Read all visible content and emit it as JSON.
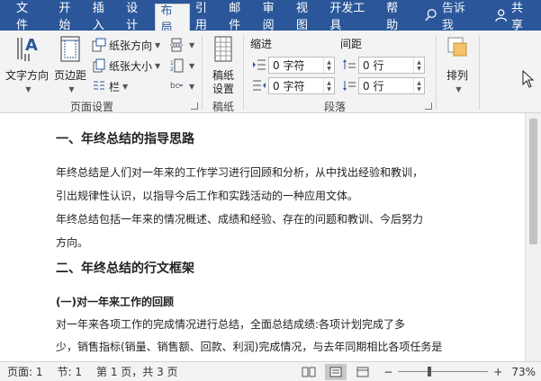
{
  "tabs": [
    {
      "label": "文件",
      "active": false
    },
    {
      "label": "开始",
      "active": false
    },
    {
      "label": "插入",
      "active": false
    },
    {
      "label": "设计",
      "active": false
    },
    {
      "label": "布局",
      "active": true
    },
    {
      "label": "引用",
      "active": false
    },
    {
      "label": "邮件",
      "active": false
    },
    {
      "label": "审阅",
      "active": false
    },
    {
      "label": "视图",
      "active": false
    },
    {
      "label": "开发工具",
      "active": false
    },
    {
      "label": "帮助",
      "active": false
    }
  ],
  "tell_me": "告诉我",
  "share": "共享",
  "ribbon": {
    "page_setup": {
      "label": "页面设置",
      "text_direction": "文字方向",
      "margins": "页边距",
      "orientation": "纸张方向",
      "size": "纸张大小",
      "columns": "栏"
    },
    "manuscript": {
      "label": "稿纸",
      "settings_line1": "稿纸",
      "settings_line2": "设置"
    },
    "paragraph": {
      "label": "段落",
      "indent_label": "缩进",
      "spacing_label": "间距",
      "indent_left": "0 字符",
      "indent_right": "0 字符",
      "spacing_before": "0 行",
      "spacing_after": "0 行"
    },
    "arrange": {
      "label": "排列"
    }
  },
  "document": {
    "lines": [
      {
        "text": "一、年终总结的指导思路",
        "style": "h1"
      },
      {
        "text": "    年终总结是人们对一年来的工作学习进行回顾和分析，从中找出经验和教训，",
        "style": "p"
      },
      {
        "text": "引出规律性认识，以指导今后工作和实践活动的一种应用文体。",
        "style": "p"
      },
      {
        "text": "    年终总结包括一年来的情况概述、成绩和经验、存在的问题和教训、今后努力",
        "style": "p"
      },
      {
        "text": "方向。",
        "style": "p"
      },
      {
        "text": "二、年终总结的行文框架",
        "style": "h1"
      },
      {
        "text": "    (一)对一年来工作的回顾",
        "style": "h3"
      },
      {
        "text": "    对一年来各项工作的完成情况进行总结，全面总结成绩:各项计划完成了多",
        "style": "p"
      },
      {
        "text": "少，销售指标(销量、销售额、回款、利润)完成情况，与去年同期相比各项任务是",
        "style": "p"
      }
    ]
  },
  "status": {
    "page": "页面: 1",
    "section": "节: 1",
    "page_of": "第 1 页，共 3 页",
    "zoom_percent": 73,
    "zoom_label": "73%",
    "minus": "−",
    "plus": "+"
  },
  "colors": {
    "ribbon_tabs_bg": "#2b579a",
    "ribbon_bg": "#f3f3f3",
    "accent_blue": "#2b579a"
  }
}
